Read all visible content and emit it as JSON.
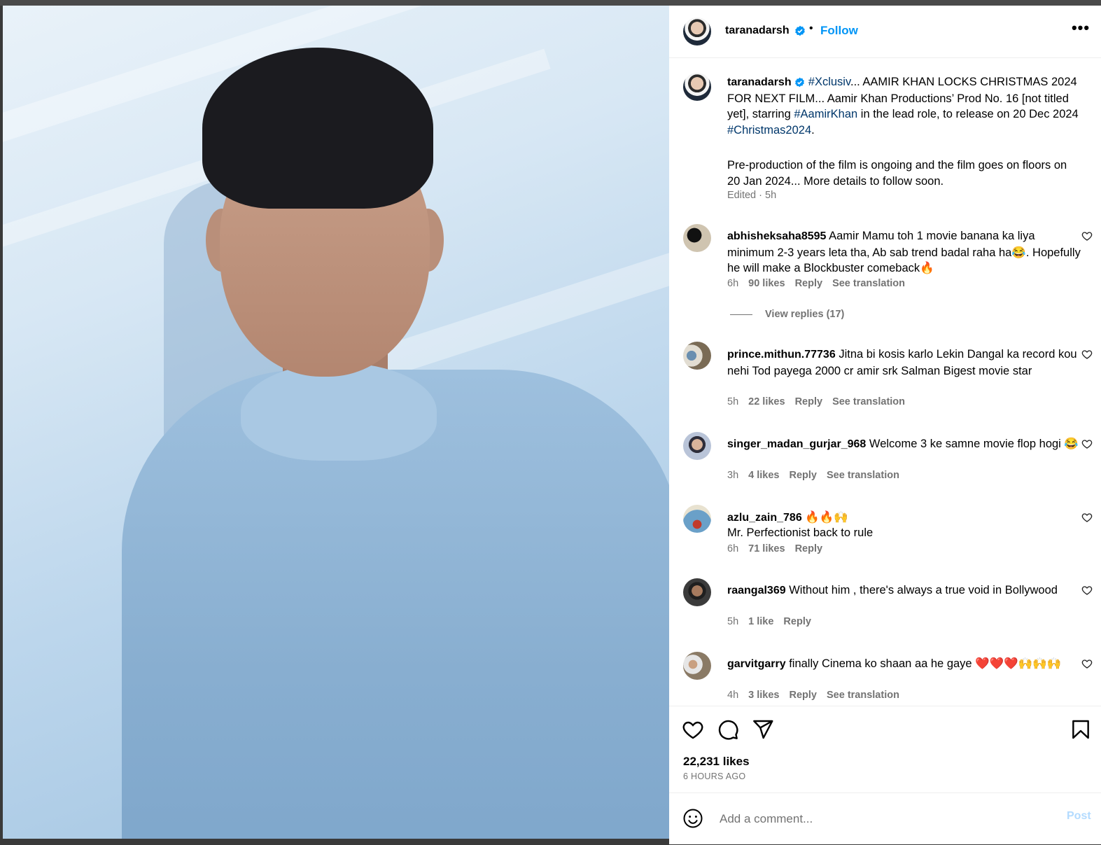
{
  "post": {
    "username": "taranadarsh",
    "follow_label": "Follow",
    "separator": "•",
    "more_label": "•••"
  },
  "caption": {
    "username": "taranadarsh",
    "hashtag1": "#Xclusiv",
    "text1a": "... AAMIR KHAN LOCKS CHRISTMAS 2024 FOR NEXT FILM... Aamir Khan Productions’ Prod No. 16 [not titled yet], starring ",
    "hashtag2": "#AamirKhan",
    "text1b": " in the lead role, to release on 20 Dec 2024 ",
    "hashtag3": "#Christmas2024",
    "text1c": ".",
    "text2": "Pre-production of the film is ongoing and the film goes on floors on 20 Jan 2024... More details to follow soon.",
    "meta": "Edited · 5h"
  },
  "comments": [
    {
      "user": "abhisheksaha8595",
      "text": "Aamir Mamu toh 1 movie banana ka liya minimum 2-3 years leta tha, Ab sab trend badal raha ha😂. Hopefully he will make a Blockbuster comeback🔥",
      "time": "6h",
      "likes": "90 likes",
      "reply": "Reply",
      "translate": "See translation"
    },
    {
      "user": "prince.mithun.77736",
      "text": "Jitna bi kosis karlo Lekin Dangal ka record kou nehi Tod payega 2000 cr amir srk Salman Bigest movie star",
      "time": "5h",
      "likes": "22 likes",
      "reply": "Reply",
      "translate": "See translation"
    },
    {
      "user": "singer_madan_gurjar_968",
      "text": "Welcome 3 ke samne movie flop hogi 😂",
      "time": "3h",
      "likes": "4 likes",
      "reply": "Reply",
      "translate": "See translation"
    },
    {
      "user": "azlu_zain_786",
      "text": "🔥🔥🙌",
      "line2": "Mr. Perfectionist back to rule",
      "time": "6h",
      "likes": "71 likes",
      "reply": "Reply",
      "translate": ""
    },
    {
      "user": "raangal369",
      "text": "Without him , there's always a true void in Bollywood",
      "time": "5h",
      "likes": "1 like",
      "reply": "Reply",
      "translate": ""
    },
    {
      "user": "garvitgarry",
      "text": "finally Cinema ko shaan aa he gaye ❤️❤️❤️🙌🙌🙌",
      "time": "4h",
      "likes": "3 likes",
      "reply": "Reply",
      "translate": "See translation"
    }
  ],
  "view_replies": "View replies (17)",
  "footer": {
    "likes": "22,231 likes",
    "ago": "6 HOURS AGO",
    "add_comment_placeholder": "Add a comment...",
    "post_label": "Post"
  }
}
